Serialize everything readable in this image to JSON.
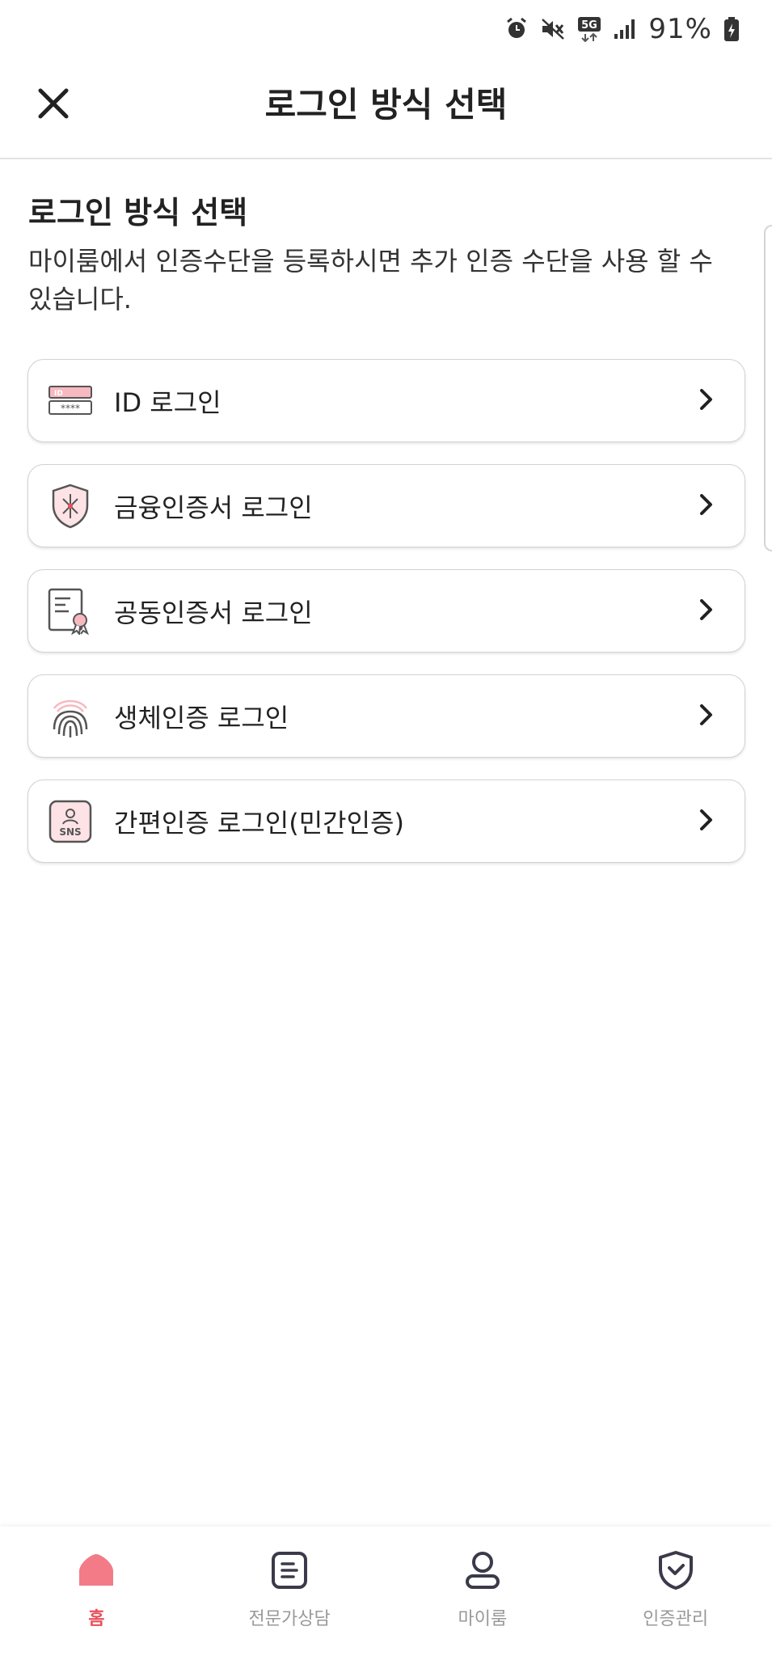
{
  "status_bar": {
    "battery_percent": "91%"
  },
  "header": {
    "title": "로그인 방식 선택",
    "close_icon": "close-icon"
  },
  "content": {
    "title": "로그인 방식 선택",
    "description": "마이룸에서 인증수단을 등록하시면 추가 인증 수단을 사용 할 수 있습니다."
  },
  "options": [
    {
      "label": "ID 로그인",
      "icon": "id-card-icon"
    },
    {
      "label": "금융인증서 로그인",
      "icon": "shield-certificate-icon"
    },
    {
      "label": "공동인증서 로그인",
      "icon": "document-certificate-icon"
    },
    {
      "label": "생체인증 로그인",
      "icon": "fingerprint-icon"
    },
    {
      "label": "간편인증 로그인(민간인증)",
      "icon": "sns-icon"
    }
  ],
  "bottom_nav": [
    {
      "label": "홈",
      "icon": "home-icon",
      "active": true
    },
    {
      "label": "전문가상담",
      "icon": "document-list-icon",
      "active": false
    },
    {
      "label": "마이룸",
      "icon": "person-icon",
      "active": false
    },
    {
      "label": "인증관리",
      "icon": "shield-check-icon",
      "active": false
    }
  ],
  "colors": {
    "accent": "#e8505b",
    "pink_light": "#f7b9c0",
    "text": "#222222",
    "nav_inactive": "#999999"
  }
}
